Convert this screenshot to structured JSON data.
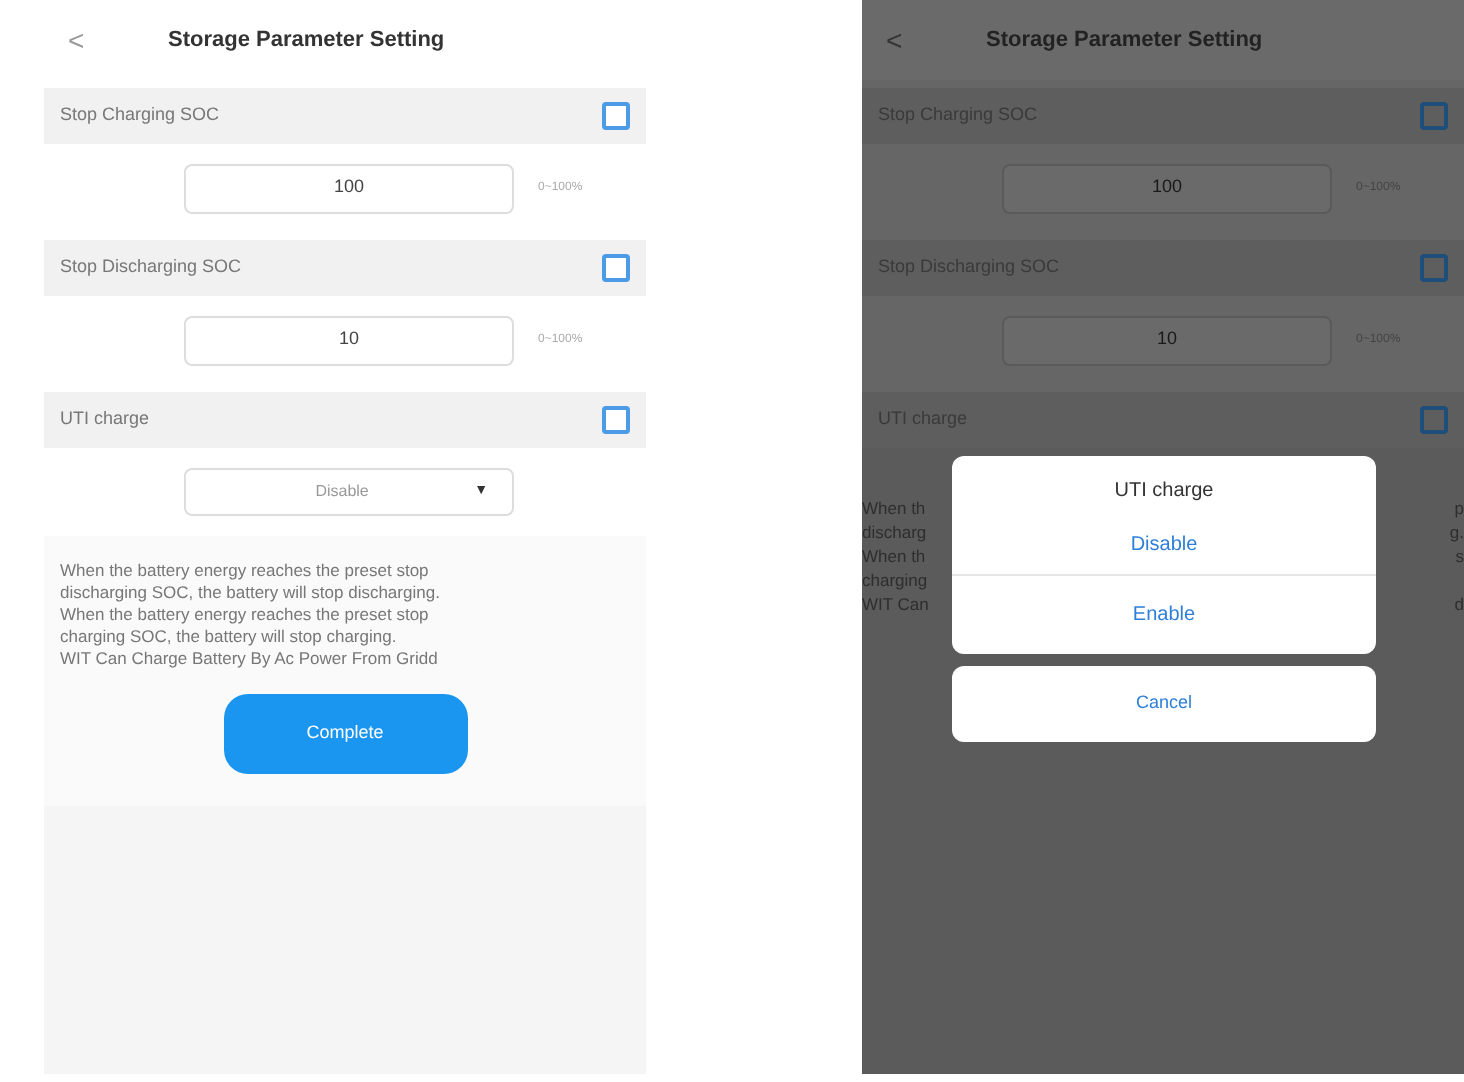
{
  "screens": [
    {
      "dimmed": false,
      "back": "<",
      "title": "Storage Parameter Setting",
      "settings": [
        {
          "kind": "input",
          "label": "Stop Charging SOC",
          "checked": false,
          "value": "100",
          "range": "0~100%"
        },
        {
          "kind": "input",
          "label": "Stop Discharging SOC",
          "checked": false,
          "value": "10",
          "range": "0~100%"
        },
        {
          "kind": "select",
          "label": "UTI charge",
          "checked": false,
          "value": "Disable",
          "caret": "▼"
        }
      ],
      "note": [
        "When the battery energy reaches the preset stop",
        "discharging SOC, the battery will stop discharging.",
        "When the battery energy reaches the preset stop",
        "charging SOC, the battery will stop charging.",
        "WIT Can Charge Battery By Ac Power From Gridd"
      ],
      "button": "Complete"
    },
    {
      "dimmed": true,
      "back": "<",
      "title": "Storage Parameter Setting",
      "settings": [
        {
          "kind": "input",
          "label": "Stop Charging SOC",
          "checked": false,
          "value": "100",
          "range": "0~100%"
        },
        {
          "kind": "input",
          "label": "Stop Discharging SOC",
          "checked": false,
          "value": "10",
          "range": "0~100%"
        },
        {
          "kind": "label",
          "label": "UTI charge",
          "checked": false
        }
      ],
      "note_fragments": [
        {
          "left": "When th",
          "right": "p"
        },
        {
          "left": "discharg",
          "right": "g."
        },
        {
          "left": "When th",
          "right": "s"
        },
        {
          "left": "charging"
        },
        {
          "left": "WIT Can",
          "right": "d"
        }
      ],
      "dialog": {
        "title": "UTI charge",
        "options": [
          "Disable",
          "Enable"
        ],
        "cancel": "Cancel"
      }
    }
  ]
}
